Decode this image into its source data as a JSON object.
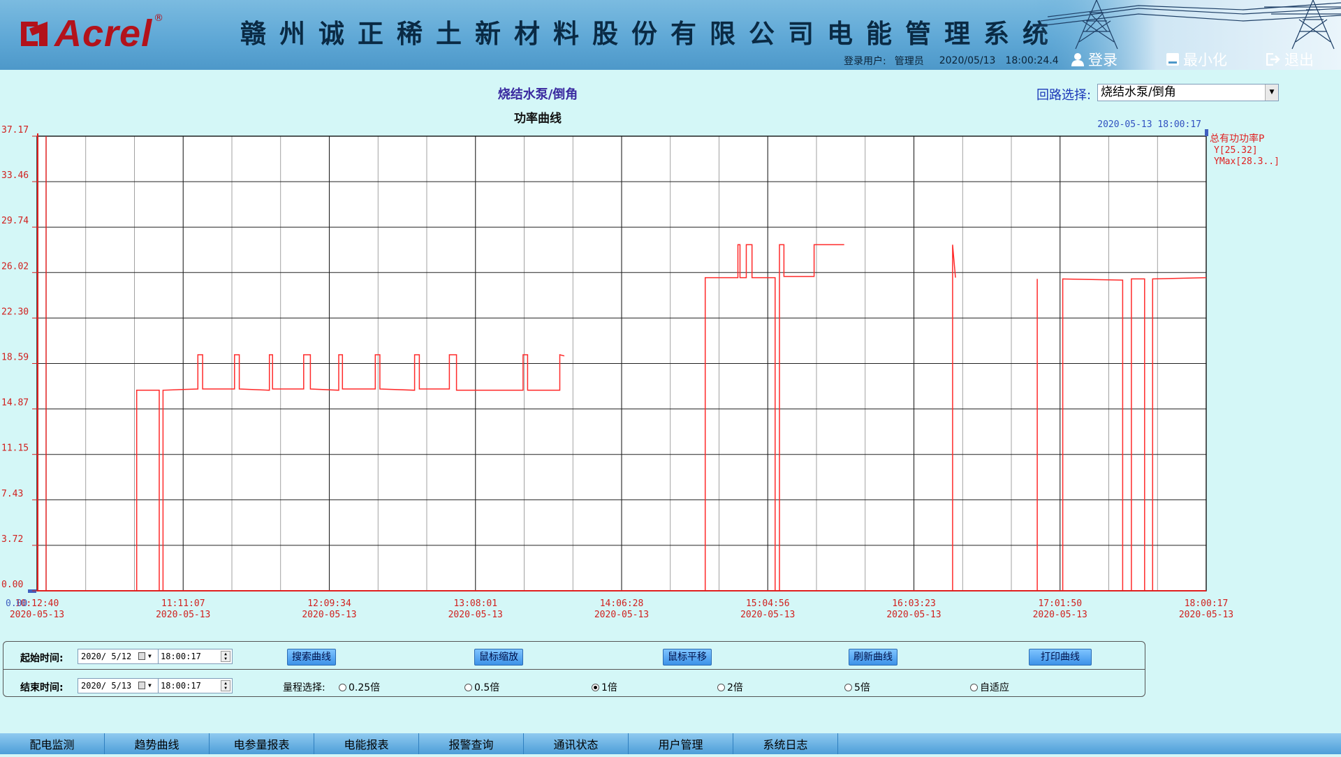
{
  "header": {
    "logo_text": "Acrel",
    "logo_reg": "®",
    "system_title": "赣州诚正稀土新材料股份有限公司电能管理系统",
    "login_user_label": "登录用户:",
    "user_name": "管理员",
    "date": "2020/05/13",
    "time": "18:00:24.4",
    "login_button": "登录",
    "minimize_button": "最小化",
    "exit_button": "退出"
  },
  "page": {
    "circuit_title": "烧结水泵/倒角",
    "chart_title": "功率曲线",
    "circuit_select_label": "回路选择:",
    "circuit_select_value": "烧结水泵/倒角"
  },
  "chart_data": {
    "type": "line",
    "title": "功率曲线",
    "top_timestamp": "2020-05-13 18:00:17",
    "y_ticks": [
      "37.17",
      "33.46",
      "29.74",
      "26.02",
      "22.30",
      "18.59",
      "14.87",
      "11.15",
      "7.43",
      "3.72",
      "0.00"
    ],
    "ylim": [
      0,
      37.17
    ],
    "x_start_time": "10:12:40",
    "x_end_time": "18:00:17",
    "x_ticks": [
      {
        "time": "10:12:40",
        "date": "2020-05-13"
      },
      {
        "time": "11:11:07",
        "date": "2020-05-13"
      },
      {
        "time": "12:09:34",
        "date": "2020-05-13"
      },
      {
        "time": "13:08:01",
        "date": "2020-05-13"
      },
      {
        "time": "14:06:28",
        "date": "2020-05-13"
      },
      {
        "time": "15:04:56",
        "date": "2020-05-13"
      },
      {
        "time": "16:03:23",
        "date": "2020-05-13"
      },
      {
        "time": "17:01:50",
        "date": "2020-05-13"
      },
      {
        "time": "18:00:17",
        "date": "2020-05-13"
      }
    ],
    "legend": {
      "series_name": "总有功功率P",
      "y_value": "Y[25.32]",
      "y_max": "YMax[28.3..]"
    },
    "corner_label": "0.00",
    "grid": true,
    "series": [
      {
        "name": "总有功功率P",
        "color": "#ff2a2a",
        "points": [
          [
            "10:52:32",
            0
          ],
          [
            "10:52:32",
            16.4
          ],
          [
            "11:01:33",
            16.4
          ],
          [
            "11:01:33",
            0
          ],
          [
            "11:03:03",
            0
          ],
          [
            "11:03:03",
            16.4
          ],
          [
            "11:17:00",
            16.5
          ],
          [
            "11:17:00",
            19.3
          ],
          [
            "11:18:54",
            19.3
          ],
          [
            "11:18:54",
            16.5
          ],
          [
            "11:31:40",
            16.5
          ],
          [
            "11:31:40",
            19.3
          ],
          [
            "11:33:34",
            19.3
          ],
          [
            "11:33:34",
            16.5
          ],
          [
            "11:45:37",
            16.4
          ],
          [
            "11:45:37",
            19.3
          ],
          [
            "11:46:52",
            19.3
          ],
          [
            "11:46:52",
            16.5
          ],
          [
            "11:59:19",
            16.5
          ],
          [
            "11:59:19",
            19.3
          ],
          [
            "12:02:00",
            19.3
          ],
          [
            "12:02:00",
            16.5
          ],
          [
            "12:13:21",
            16.4
          ],
          [
            "12:13:21",
            19.3
          ],
          [
            "12:14:50",
            19.3
          ],
          [
            "12:14:50",
            16.5
          ],
          [
            "12:27:57",
            16.5
          ],
          [
            "12:27:57",
            19.3
          ],
          [
            "12:29:48",
            19.3
          ],
          [
            "12:29:48",
            16.5
          ],
          [
            "12:43:40",
            16.4
          ],
          [
            "12:43:40",
            19.3
          ],
          [
            "12:45:34",
            19.3
          ],
          [
            "12:45:34",
            16.5
          ],
          [
            "12:57:36",
            16.5
          ],
          [
            "12:57:36",
            19.3
          ],
          [
            "13:00:27",
            19.3
          ],
          [
            "13:00:27",
            16.4
          ],
          [
            "13:27:04",
            16.4
          ],
          [
            "13:27:04",
            19.3
          ],
          [
            "13:28:53",
            19.3
          ],
          [
            "13:28:53",
            16.4
          ],
          [
            "13:41:46",
            16.4
          ],
          [
            "13:41:46",
            19.3
          ],
          [
            "13:43:34",
            19.2
          ],
          [
            "14:39:55",
            0
          ],
          [
            "14:39:55",
            25.6
          ],
          [
            "14:52:59",
            25.6
          ],
          [
            "14:52:59",
            28.3
          ],
          [
            "14:53:49",
            28.3
          ],
          [
            "14:53:49",
            25.6
          ],
          [
            "14:56:20",
            25.6
          ],
          [
            "14:56:20",
            28.3
          ],
          [
            "14:58:37",
            28.3
          ],
          [
            "14:58:37",
            25.6
          ],
          [
            "15:07:53",
            25.6
          ],
          [
            "15:07:53",
            0
          ],
          [
            "15:09:36",
            0
          ],
          [
            "15:09:36",
            28.3
          ],
          [
            "15:11:24",
            28.3
          ],
          [
            "15:11:24",
            25.7
          ],
          [
            "15:23:27",
            25.7
          ],
          [
            "15:23:27",
            28.3
          ],
          [
            "15:35:30",
            28.3
          ],
          [
            "16:18:52",
            0
          ],
          [
            "16:18:52",
            28.3
          ],
          [
            "16:20:00",
            25.6
          ],
          [
            "16:52:43",
            25.5
          ],
          [
            "16:52:43",
            0
          ],
          [
            "17:02:55",
            0
          ],
          [
            "17:02:55",
            25.5
          ],
          [
            "17:26:52",
            25.4
          ],
          [
            "17:26:52",
            0
          ],
          [
            "17:30:22",
            0
          ],
          [
            "17:30:22",
            25.5
          ],
          [
            "17:35:39",
            25.5
          ],
          [
            "17:35:39",
            0
          ],
          [
            "17:38:51",
            0
          ],
          [
            "17:38:51",
            25.5
          ],
          [
            "18:00:17",
            25.6
          ]
        ]
      }
    ]
  },
  "controls": {
    "start_label": "起始时间:",
    "start_date": "2020/ 5/12",
    "start_time": "18:00:17",
    "end_label": "结束时间:",
    "end_date": "2020/ 5/13",
    "end_time": "18:00:17",
    "buttons": [
      "搜索曲线",
      "鼠标缩放",
      "鼠标平移",
      "刷新曲线",
      "打印曲线"
    ],
    "range_label": "量程选择:",
    "range_options": [
      "0.25倍",
      "0.5倍",
      "1倍",
      "2倍",
      "5倍",
      "自适应"
    ],
    "range_selected": "1倍"
  },
  "nav": {
    "items": [
      "配电监测",
      "趋势曲线",
      "电参量报表",
      "电能报表",
      "报警查询",
      "通讯状态",
      "用户管理",
      "系统日志"
    ]
  },
  "colors": {
    "background": "#d4f7f7",
    "header": "#5fa8d6",
    "curve": "#ff2a2a",
    "axis_labels": "#d1201e",
    "nav": "#6db4e6"
  }
}
